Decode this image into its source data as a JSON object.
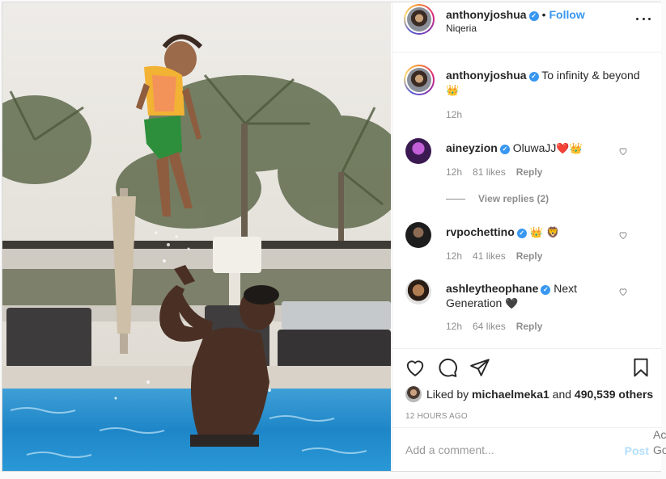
{
  "post": {
    "author": "anthonyjoshua",
    "follow_label": "Follow",
    "separator": "•",
    "location": "Niqeria"
  },
  "caption": {
    "username": "anthonyjoshua",
    "text": "To infinity & beyond",
    "emoji": "👑",
    "time": "12h"
  },
  "comments": [
    {
      "username": "aineyzion",
      "text": "OluwaJJ",
      "emoji": "❤️👑",
      "time": "12h",
      "likes": "81 likes",
      "reply": "Reply"
    },
    {
      "username": "rvpochettino",
      "text": "",
      "emoji": "👑 🦁",
      "time": "12h",
      "likes": "41 likes",
      "reply": "Reply"
    },
    {
      "username": "ashleytheophane",
      "text": "Next Generation",
      "emoji": "🖤",
      "time": "12h",
      "likes": "64 likes",
      "reply": "Reply"
    }
  ],
  "view_replies": "View replies (2)",
  "likes": {
    "prefix": "Liked by",
    "user": "michaelmeka1",
    "middle": "and",
    "others": "490,539 others"
  },
  "timestamp": "12 HOURS AGO",
  "add_comment": {
    "placeholder": "Add a comment...",
    "post_label": "Post"
  },
  "edge_text": {
    "top": "Ac",
    "bottom": "Go"
  },
  "icons": {
    "more": "more-options-icon",
    "like": "heart-icon",
    "comment": "comment-icon",
    "share": "paper-plane-icon",
    "save": "bookmark-icon",
    "verified": "verified-badge-icon"
  },
  "colors": {
    "link": "#3897f0",
    "verified": "#3897f0",
    "muted": "#8e8e8e",
    "post_disabled": "#b2dffc"
  }
}
